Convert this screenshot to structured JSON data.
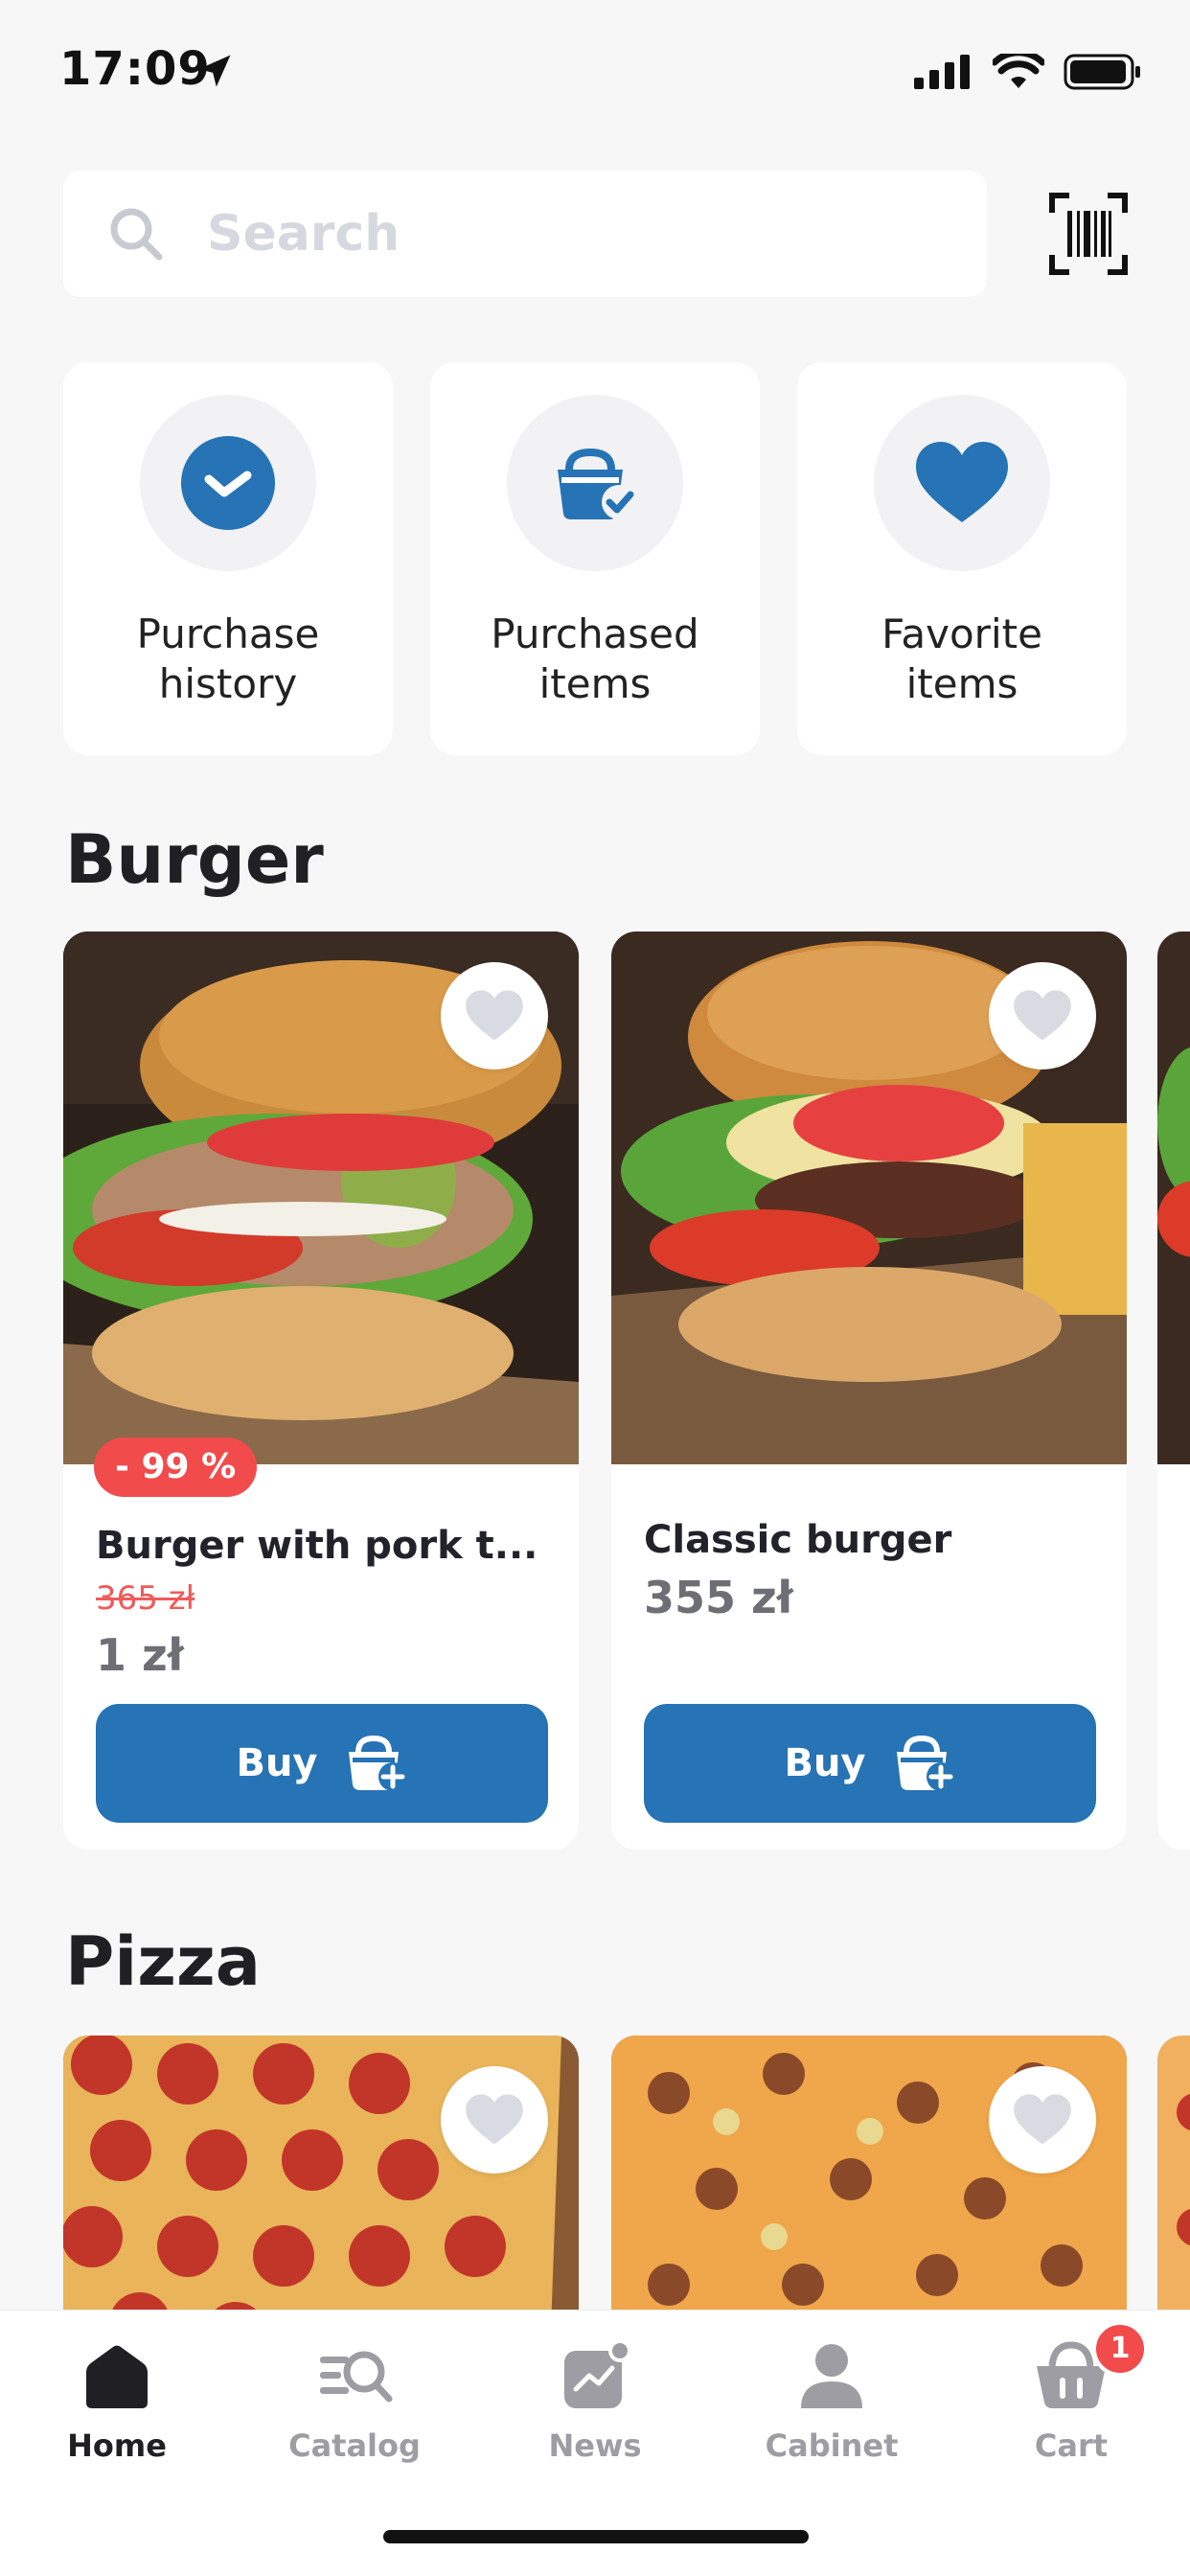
{
  "status_bar": {
    "time": "17:09"
  },
  "search": {
    "placeholder": "Search",
    "value": ""
  },
  "quick_actions": [
    {
      "label": "Purchase\nhistory",
      "icon": "check-circle-icon"
    },
    {
      "label": "Purchased\nitems",
      "icon": "bag-check-icon"
    },
    {
      "label": "Favorite\nitems",
      "icon": "heart-icon"
    }
  ],
  "sections": [
    {
      "title": "Burger",
      "products": [
        {
          "name": "Burger with pork t...",
          "old_price": "365 zł",
          "price": "1 zł",
          "discount": "- 99 %",
          "buy_label": "Buy"
        },
        {
          "name": "Classic burger",
          "price": "355 zł",
          "buy_label": "Buy"
        }
      ]
    },
    {
      "title": "Pizza",
      "products": [
        {
          "name": "",
          "price": ""
        },
        {
          "name": "",
          "price": ""
        }
      ]
    }
  ],
  "tab_bar": {
    "tabs": [
      {
        "label": "Home",
        "icon": "home-icon",
        "active": true
      },
      {
        "label": "Catalog",
        "icon": "catalog-search-icon",
        "active": false
      },
      {
        "label": "News",
        "icon": "news-chart-icon",
        "active": false
      },
      {
        "label": "Cabinet",
        "icon": "person-icon",
        "active": false
      },
      {
        "label": "Cart",
        "icon": "basket-icon",
        "active": false
      }
    ],
    "cart_count": "1"
  },
  "colors": {
    "accent": "#2673b5",
    "badge": "#f24b4b",
    "background": "#f7f7f8",
    "inactive": "#9d9da3"
  }
}
